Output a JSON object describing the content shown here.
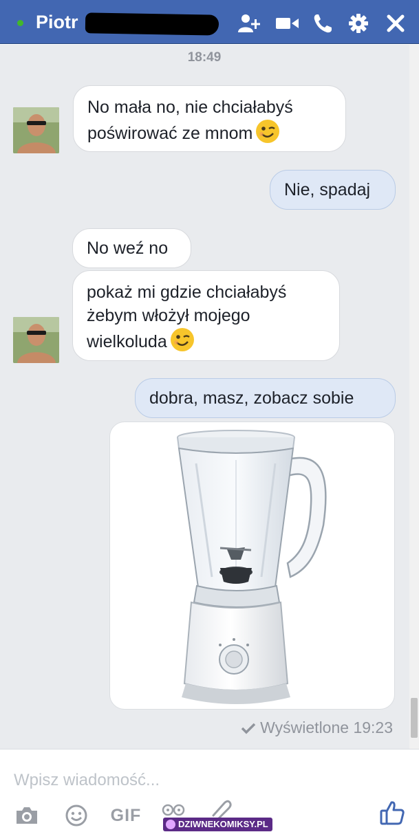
{
  "header": {
    "name": "Piotr",
    "icons": [
      "add-people-icon",
      "video-call-icon",
      "phone-icon",
      "settings-icon",
      "close-icon"
    ]
  },
  "conversation": {
    "timestamp": "18:49",
    "messages": [
      {
        "from": "them",
        "text": "No mała no, nie chciałabyś poświrować ze mnom",
        "emoji": "wink"
      },
      {
        "from": "me",
        "text": "Nie, spadaj"
      },
      {
        "from": "them",
        "text": "No weź no"
      },
      {
        "from": "them",
        "text": "pokaż mi gdzie chciałabyś żebym włożył mojego wielkoluda",
        "emoji": "wink"
      },
      {
        "from": "me",
        "text": "dobra, masz, zobacz sobie"
      },
      {
        "from": "me",
        "type": "image",
        "image": "blender"
      }
    ],
    "seen": "Wyświetlone 19:23"
  },
  "composer": {
    "placeholder": "Wpisz wiadomość...",
    "gif_label": "GIF",
    "watermark": "DZIWNEKOMIKSY.PL"
  },
  "colors": {
    "header": "#4267b2",
    "online": "#42b72a",
    "chat_bg": "#e9ebee",
    "outgoing": "#dfe8f6",
    "like": "#4267b2"
  }
}
